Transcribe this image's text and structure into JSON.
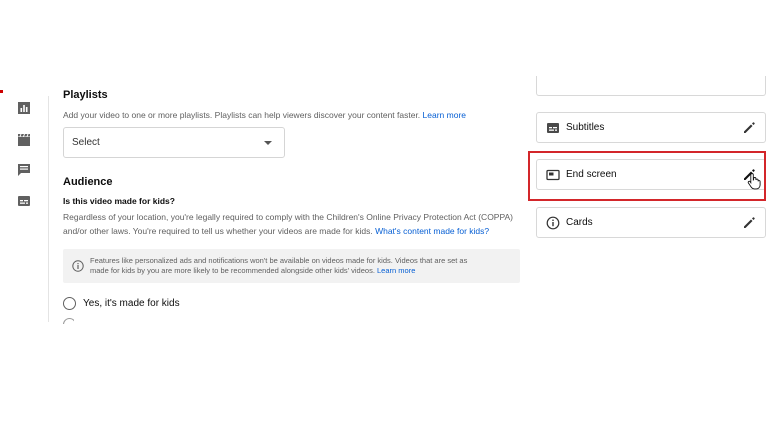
{
  "sidebar": {
    "icons": [
      "analytics-icon",
      "clapperboard-icon",
      "comments-icon",
      "subtitles-icon"
    ]
  },
  "playlists": {
    "title": "Playlists",
    "description": "Add your video to one or more playlists. Playlists can help viewers discover your content faster.",
    "learn_more": "Learn more",
    "select_value": "Select"
  },
  "audience": {
    "title": "Audience",
    "question": "Is this video made for kids?",
    "paragraph_line1": "Regardless of your location, you're legally required to comply with the Children's Online Privacy Protection Act (COPPA)",
    "paragraph_line2": "and/or other laws. You're required to tell us whether your videos are made for kids.",
    "paragraph_link": "What's content made for kids?",
    "info_line1": "Features like personalized ads and notifications won't be available on videos made for kids. Videos that are set as",
    "info_line2": "made for kids by you are more likely to be recommended alongside other kids' videos.",
    "info_link": "Learn more",
    "option_yes": "Yes, it's made for kids"
  },
  "right_panel": {
    "items": [
      {
        "label": "Subtitles",
        "icon": "subtitles-icon"
      },
      {
        "label": "End screen",
        "icon": "end-screen-icon"
      },
      {
        "label": "Cards",
        "icon": "info-icon"
      }
    ]
  },
  "colors": {
    "highlight": "#d3262a",
    "link": "#065fd4"
  }
}
